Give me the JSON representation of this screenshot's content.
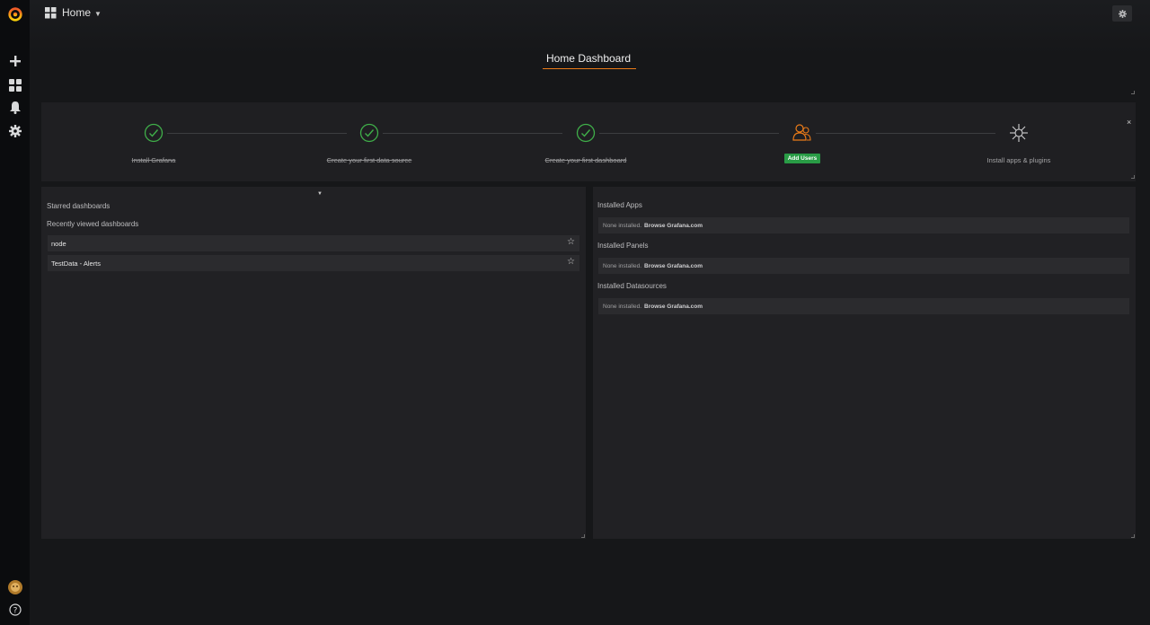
{
  "navbar": {
    "home_label": "Home"
  },
  "page": {
    "title": "Home Dashboard"
  },
  "getting_started": {
    "close_label": "×",
    "steps": [
      {
        "label": "Install Grafana",
        "status": "done",
        "icon": "check-circle-icon"
      },
      {
        "label": "Create your first data source",
        "status": "done",
        "icon": "check-circle-icon"
      },
      {
        "label": "Create your first dashboard",
        "status": "done",
        "icon": "check-circle-icon"
      },
      {
        "label": "Add Users",
        "status": "active",
        "icon": "users-icon"
      },
      {
        "label": "Install apps & plugins",
        "status": "todo",
        "icon": "plugins-icon"
      }
    ]
  },
  "left_panel": {
    "starred_heading": "Starred dashboards",
    "recent_heading": "Recently viewed dashboards",
    "recent": [
      {
        "title": "node"
      },
      {
        "title": "TestData - Alerts"
      }
    ]
  },
  "right_panel": {
    "sections": [
      {
        "heading": "Installed Apps",
        "none_text": "None installed.",
        "browse_text": "Browse Grafana.com"
      },
      {
        "heading": "Installed Panels",
        "none_text": "None installed.",
        "browse_text": "Browse Grafana.com"
      },
      {
        "heading": "Installed Datasources",
        "none_text": "None installed.",
        "browse_text": "Browse Grafana.com"
      }
    ]
  },
  "colors": {
    "accent_orange": "#eb7b18",
    "success_green": "#299c46",
    "check_green": "#3fae49"
  }
}
